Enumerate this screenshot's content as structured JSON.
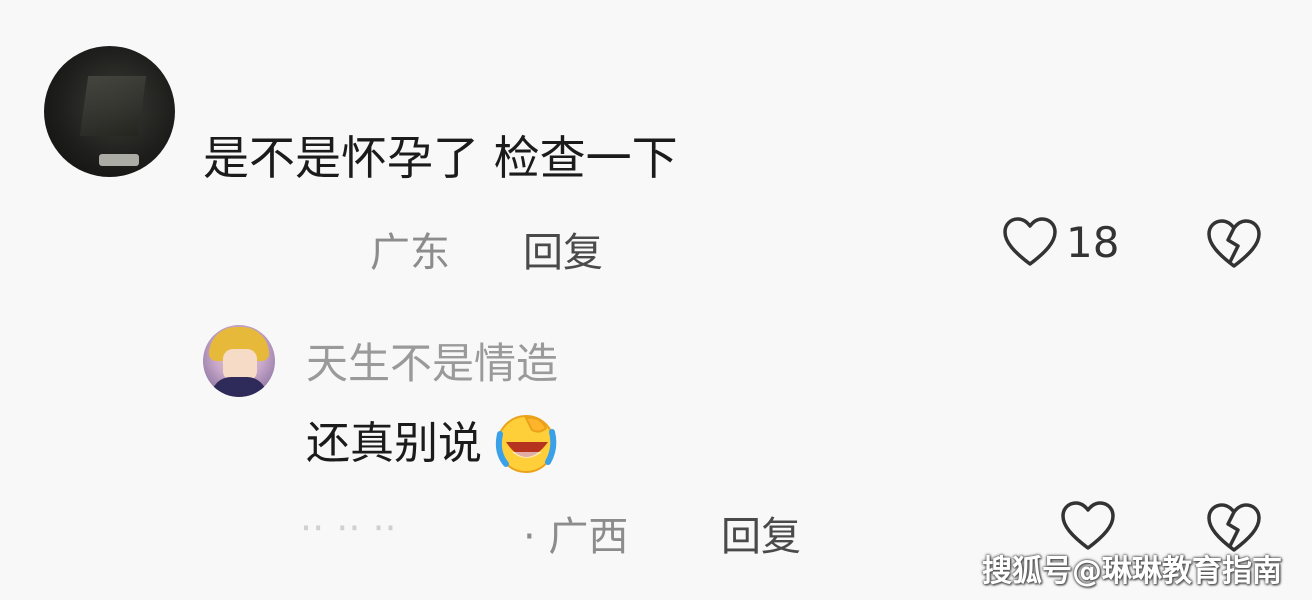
{
  "comment": {
    "text": "是不是怀孕了 检查一下",
    "location": "广东",
    "reply_label": "回复",
    "like_count": "18",
    "icons": {
      "like": "heart-outline-icon",
      "dislike": "broken-heart-icon"
    }
  },
  "reply": {
    "username": "天生不是情造",
    "text": "还真别说",
    "emoji": "laughing-crying-face-emoji",
    "partial_time": "⋅⋅ ⋅⋅ ⋅⋅",
    "separator_location": "· 广西",
    "reply_label": "回复",
    "icons": {
      "like": "heart-outline-icon",
      "dislike": "broken-heart-icon"
    }
  },
  "watermark": "搜狐号@琳琳教育指南",
  "colors": {
    "background": "#f8f8f8",
    "text_primary": "#1b1b1b",
    "text_secondary": "#8c8c8c",
    "reply_name": "#9a9a9a"
  }
}
